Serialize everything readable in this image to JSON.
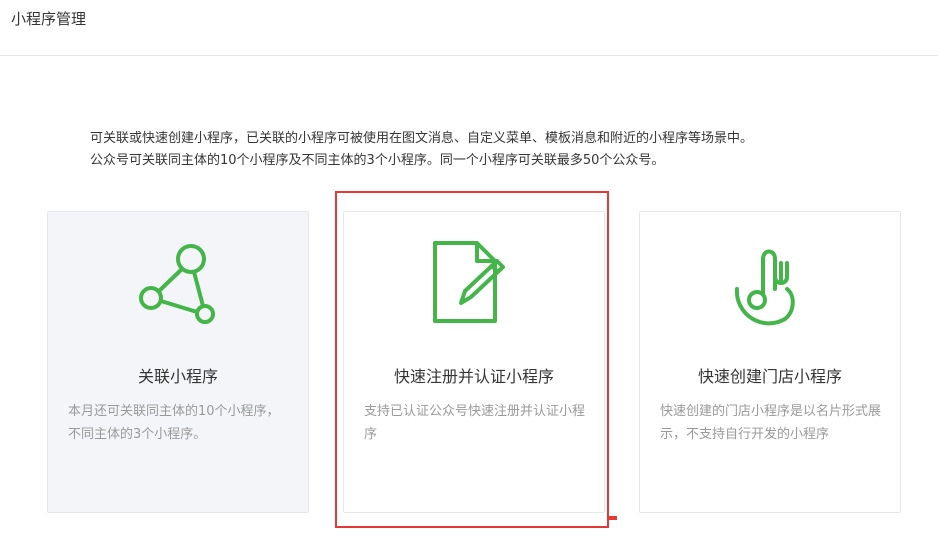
{
  "header": {
    "title": "小程序管理"
  },
  "intro": {
    "line1": "可关联或快速创建小程序，已关联的小程序可被使用在图文消息、自定义菜单、模板消息和附近的小程序等场景中。",
    "line2": "公众号可关联同主体的10个小程序及不同主体的3个小程序。同一个小程序可关联最多50个公众号。"
  },
  "cards": [
    {
      "icon": "network-nodes-icon",
      "title": "关联小程序",
      "desc": "本月还可关联同主体的10个小程序，不同主体的3个小程序。"
    },
    {
      "icon": "document-pencil-icon",
      "title": "快速注册并认证小程序",
      "desc": "支持已认证公众号快速注册并认证小程序"
    },
    {
      "icon": "restaurant-fork-icon",
      "title": "快速创建门店小程序",
      "desc": "快速创建的门店小程序是以名片形式展示，不支持自行开发的小程序"
    }
  ],
  "colors": {
    "accent_green": "#44b549",
    "highlight_red": "#e53935"
  }
}
